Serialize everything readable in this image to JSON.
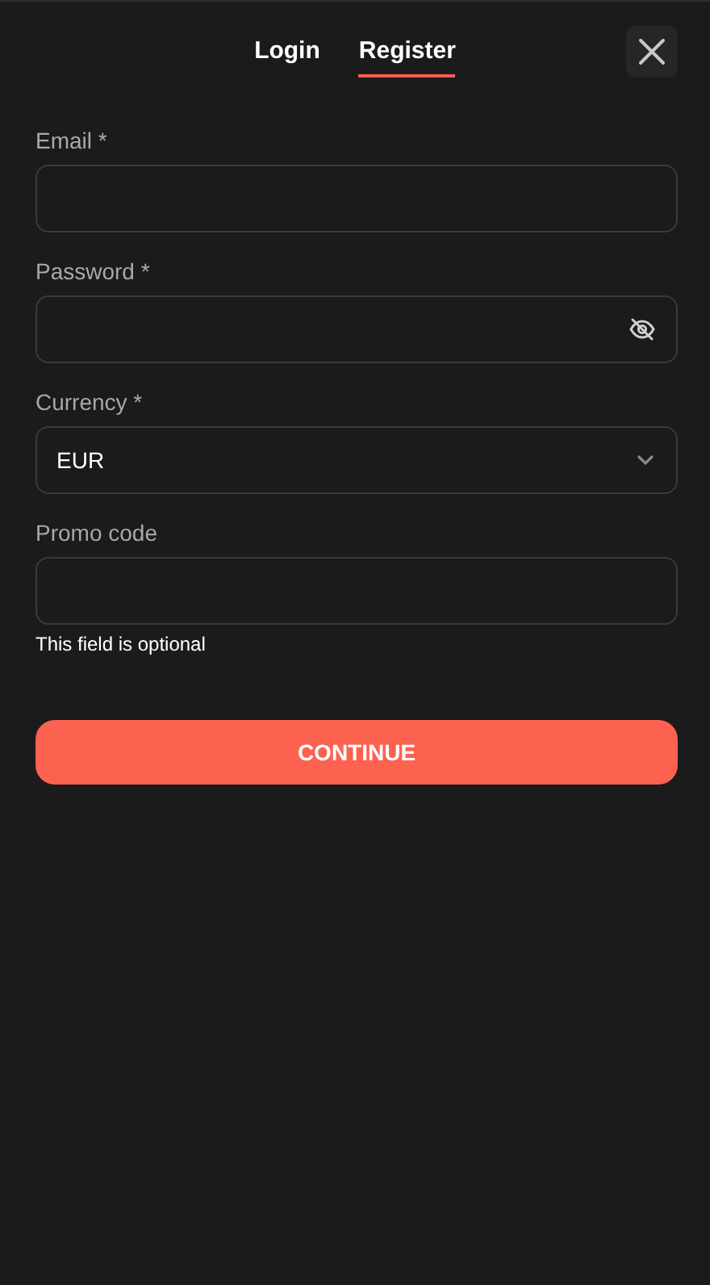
{
  "tabs": [
    {
      "label": "Login",
      "selected": false
    },
    {
      "label": "Register",
      "selected": true
    }
  ],
  "fields": [
    {
      "kind": "text",
      "label": "Email *"
    },
    {
      "kind": "password",
      "label": "Password *"
    },
    {
      "kind": "select",
      "label": "Currency *",
      "value": "EUR"
    },
    {
      "kind": "text",
      "label": "Promo code",
      "hint": "This field is optional"
    }
  ],
  "continue_button": "CONTINUE"
}
